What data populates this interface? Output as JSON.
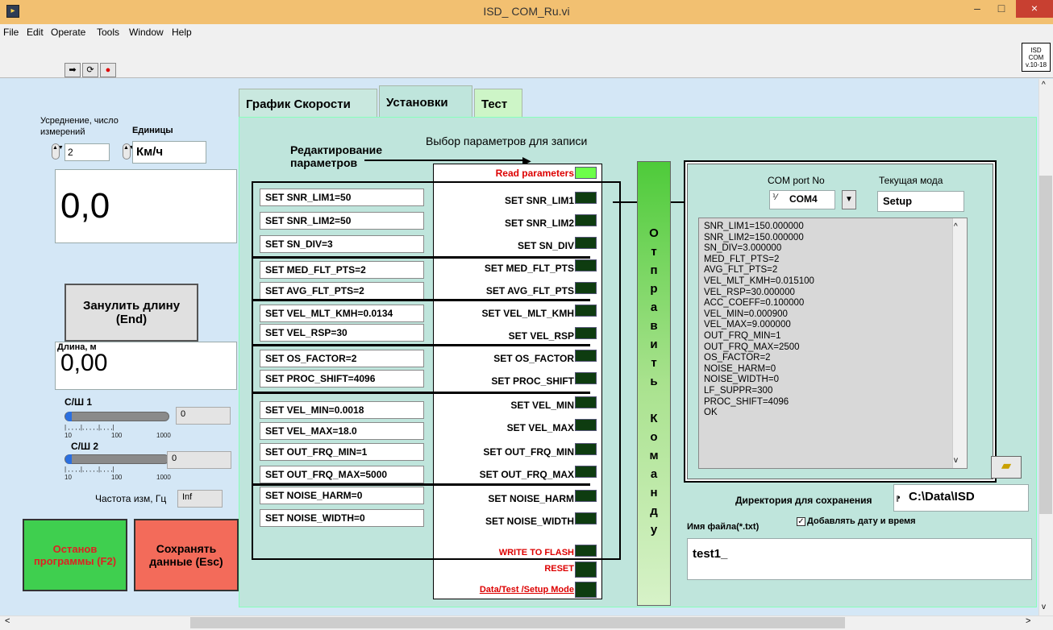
{
  "window": {
    "title": "ISD_ COM_Ru.vi",
    "icon": "labview-icon",
    "min": "–",
    "max": "□",
    "close": "×"
  },
  "menu": [
    "File",
    "Edit",
    "Operate",
    "Tools",
    "Window",
    "Help"
  ],
  "toolbar": {
    "icons": [
      "run-arrow-icon",
      "run-continuous-icon",
      "abort-icon"
    ],
    "vi_icon_text": "ISD COM v.10-18"
  },
  "left": {
    "avg_label": "Усреднение, число измерений",
    "avg_value": "2",
    "units_label": "Единицы",
    "units_value": "Км/ч",
    "speed_value": "0,0",
    "reset_len_button": "Занулить длину (End)",
    "length_label": "Длина, м",
    "length_value": "0,00",
    "snr1_label": "С/Ш 1",
    "snr1_value": "0",
    "snr2_label": "С/Ш 2",
    "snr2_value": "0",
    "ticks": [
      "10",
      "100",
      "1000"
    ],
    "freq_label": "Частота изм, Гц",
    "freq_value": "Inf",
    "stop_button": "Останов программы (F2)",
    "save_button": "Сохранять данные (Esc)"
  },
  "tabs": [
    {
      "label": "График Скорости",
      "active": false
    },
    {
      "label": "Установки",
      "active": true
    },
    {
      "label": "Тест",
      "active": false
    }
  ],
  "panel": {
    "edit_label": "Редактирование параметров",
    "select_label": "Выбор параметров для записи",
    "read_params": "Read parameters",
    "edit_rows": [
      "SET SNR_LIM1=50",
      "SET SNR_LIM2=50",
      "SET SN_DIV=3",
      "SET MED_FLT_PTS=2",
      "SET AVG_FLT_PTS=2",
      "SET VEL_MLT_KMH=0.0134",
      "SET VEL_RSP=30",
      "SET OS_FACTOR=2",
      "SET PROC_SHIFT=4096",
      "SET VEL_MIN=0.0018",
      "SET VEL_MAX=18.0",
      "SET OUT_FRQ_MIN=1",
      "SET OUT_FRQ_MAX=5000",
      "SET NOISE_HARM=0",
      "SET NOISE_WIDTH=0"
    ],
    "set_rows": [
      "SET SNR_LIM1",
      "SET SNR_LIM2",
      "SET SN_DIV",
      "SET MED_FLT_PTS",
      "SET AVG_FLT_PTS",
      "SET VEL_MLT_KMH",
      "SET VEL_RSP",
      "SET OS_FACTOR",
      "SET PROC_SHIFT",
      "SET VEL_MIN",
      "SET VEL_MAX",
      "SET OUT_FRQ_MIN",
      "SET OUT_FRQ_MAX",
      "SET NOISE_HARM",
      "SET NOISE_WIDTH"
    ],
    "write_flash": "WRITE TO FLASH",
    "reset": "RESET",
    "mode": "Data/Test /Setup Mode",
    "send_button": "Отправить Команду",
    "com_label": "COM port No",
    "com_value": "COM4",
    "mode_label": "Текущая мода",
    "mode_value": "Setup",
    "response_lines": [
      "SNR_LIM1=150.000000",
      "SNR_LIM2=150.000000",
      "SN_DIV=3.000000",
      "MED_FLT_PTS=2",
      "AVG_FLT_PTS=2",
      "VEL_MLT_KMH=0.015100",
      "VEL_RSP=30.000000",
      "ACC_COEFF=0.100000",
      "VEL_MIN=0.000900",
      "VEL_MAX=9.000000",
      "OUT_FRQ_MIN=1",
      "OUT_FRQ_MAX=2500",
      "OS_FACTOR=2",
      "NOISE_HARM=0",
      "NOISE_WIDTH=0",
      "LF_SUPPR=300",
      "PROC_SHIFT=4096",
      "OK"
    ],
    "dir_label": "Директория для сохранения",
    "dir_value": "C:\\Data\\ISD",
    "filename_label": "Имя файла(*.txt)",
    "add_date_label": "Добавлять дату и время",
    "filename_value": "test1_"
  },
  "colors": {
    "titlebar": "#f2c071",
    "panel": "#bfe5dc",
    "stop": "#3fcf4f",
    "save": "#f36b5a",
    "led_on": "#6cff4a",
    "led_off": "#0e3c10"
  }
}
